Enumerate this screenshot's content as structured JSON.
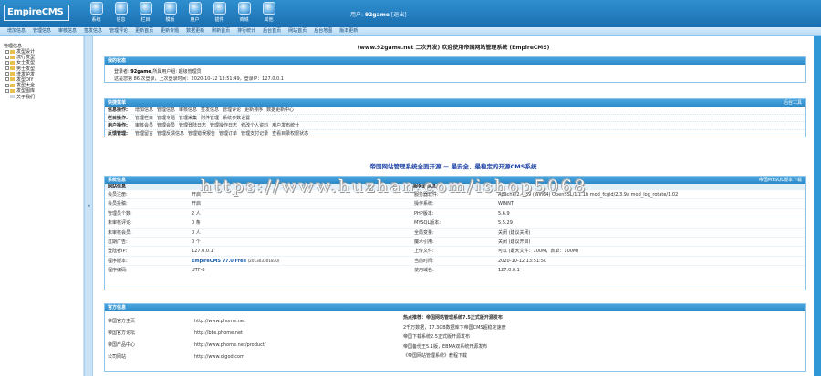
{
  "app": {
    "logo": "EmpireCMS"
  },
  "toolbar": {
    "items": [
      {
        "label": "系统",
        "icon": "system-icon"
      },
      {
        "label": "信息",
        "icon": "info-icon"
      },
      {
        "label": "栏目",
        "icon": "column-icon"
      },
      {
        "label": "模板",
        "icon": "template-icon"
      },
      {
        "label": "用户",
        "icon": "user-icon"
      },
      {
        "label": "插件",
        "icon": "plugin-icon"
      },
      {
        "label": "商城",
        "icon": "shop-icon"
      },
      {
        "label": "其他",
        "icon": "other-icon"
      }
    ]
  },
  "user": {
    "label": "用户:",
    "name": "92game",
    "logout": "[退出]"
  },
  "menu": [
    "增加信息",
    "管理信息",
    "审核信息",
    "签发信息",
    "管理评论",
    "更新首页",
    "更新专题",
    "数据更新",
    "刷新首页",
    "排行统计",
    "后台首页",
    "网站首页",
    "后台地图",
    "版本更新"
  ],
  "tree": {
    "title": "管理信息",
    "items": [
      "发型设计",
      "流行发型",
      "女士发型",
      "男士发型",
      "洗发护发",
      "发型DIY",
      "发型大全",
      "发型图库",
      "关于我们"
    ]
  },
  "main": {
    "headline": "(www.92game.net 二次开发) 欢迎使用帝国网站管理系统 (EmpireCMS)",
    "status": {
      "title": "我的状态",
      "line1_prefix": "登录者:",
      "user": "92game",
      "line1_suffix": ",所属用户组: 超级管理员",
      "line2": "这是您第 86 次登录，上次登录时间：2020-10-12 13:51:49，登录IP：127.0.0.1"
    },
    "quick": {
      "title": "快捷菜单",
      "right": "后台工具",
      "rows": [
        {
          "key": "信息操作:",
          "links": [
            "增加信息",
            "管理信息",
            "审核信息",
            "签发信息",
            "管理评论",
            "更新排序",
            "数据更新中心"
          ]
        },
        {
          "key": "栏目操作:",
          "links": [
            "管理栏目",
            "管理专题",
            "管理采集",
            "附件管理",
            "系统参数设置"
          ]
        },
        {
          "key": "用户操作:",
          "links": [
            "审核会员",
            "管理会员",
            "管理登陆日志",
            "管理操作日志",
            "修改个人资料",
            "用户发布统计"
          ]
        },
        {
          "key": "反馈管理:",
          "links": [
            "管理留言",
            "管理反馈信息",
            "管理错误报告",
            "管理订单",
            "管理支付记录",
            "查看目录权限状态"
          ]
        }
      ]
    },
    "banner": "帝国网站管理系统全面开源 － 最安全、最稳定的开源CMS系统",
    "sysinfo": {
      "title": "系统信息",
      "right": "帝国MYSQL版本下载",
      "sub_left": "网站信息",
      "sub_right": "服务器信息",
      "rows": [
        [
          "会员注册:",
          "开启",
          "服务器软件:",
          "Apache/2.4.39 (Win64) OpenSSL/1.1.1b mod_fcgid/2.3.9a mod_log_rotate/1.02"
        ],
        [
          "会员投稿:",
          "开启",
          "操作系统:",
          "WINNT"
        ],
        [
          "管理员个数:",
          "2 人",
          "PHP版本:",
          "5.6.9"
        ],
        [
          "未审核评论:",
          "0 条",
          "MYSQL版本:",
          "5.5.29"
        ],
        [
          "未审核会员:",
          "0 人",
          "全局变量:",
          "关闭 (建议关闭)"
        ],
        [
          "过期广告:",
          "0 个",
          "魔术引用:",
          "关闭 (建议开启)"
        ],
        [
          "登陆者IP:",
          "127.0.0.1",
          "上传文件:",
          "可以 (最大文件：100M，表单：100M)"
        ],
        [
          "程序版本:",
          "EmpireCMS v7.0 Free",
          "当前时间:",
          "2020-10-12 13:51:50"
        ],
        [
          "程序编码:",
          "UTF-8",
          "使用域名:",
          "127.0.0.1"
        ]
      ],
      "version_note": "(201303301830)"
    },
    "official": {
      "title": "官方信息",
      "rows": [
        [
          "帝国官方主页",
          "http://www.phome.net"
        ],
        [
          "帝国官方论坛",
          "http://bbs.phome.net"
        ],
        [
          "帝国产品中心",
          "http://www.phome.net/product/"
        ],
        [
          "公司网站",
          "http://www.digod.com"
        ]
      ],
      "news": [
        "热点推荐：帝国网站管理系统7.5正式版开源发布",
        "2千万数据，17.3GB数据库下帝国CMS超稳定速度",
        "帝国下载系统2.5正式版开源发布",
        "帝国备份王5.1版，EBMA双系统开源发布",
        "《帝国网站管理系统》教程下载"
      ]
    }
  },
  "watermark": "https://www.huzhan.com/ishop5068"
}
